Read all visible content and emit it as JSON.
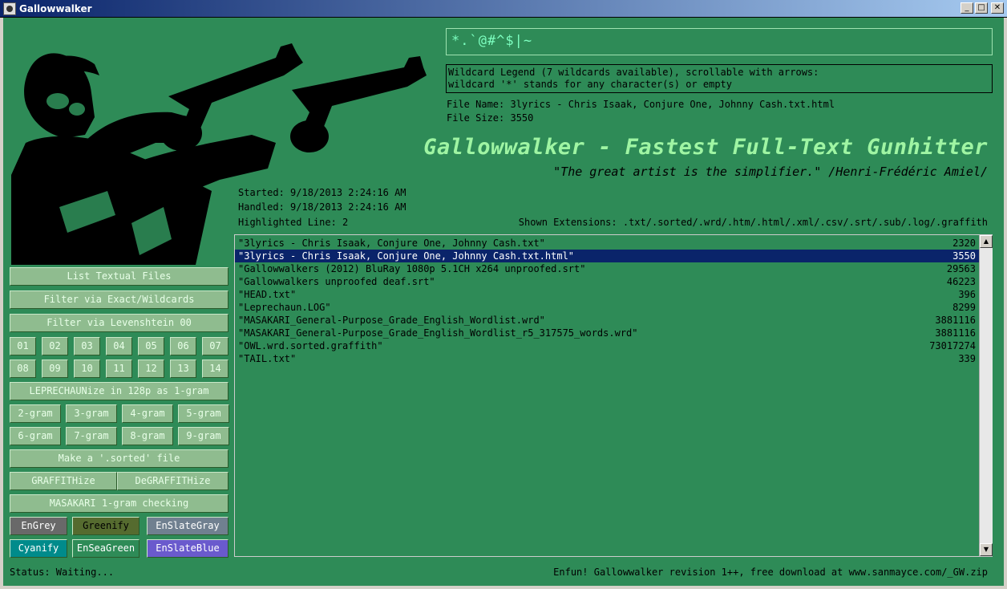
{
  "window": {
    "title": "Gallowwalker",
    "min": "_",
    "max": "□",
    "close": "✕"
  },
  "search": {
    "value": "*.`@#^$|~"
  },
  "legend": {
    "line1": "Wildcard Legend (7 wildcards available), scrollable with arrows:",
    "line2": "wildcard '*' stands for any character(s) or empty"
  },
  "file_info": {
    "name": "File Name: 3lyrics - Chris Isaak, Conjure One, Johnny Cash.txt.html",
    "size": "File Size: 3550"
  },
  "headline": {
    "title": "Gallowwalker - Fastest Full-Text Gunhitter",
    "quote": "\"The great artist is the simplifier.\" /Henri-Frédéric Amiel/"
  },
  "timing": {
    "started": "Started: 9/18/2013 2:24:16 AM",
    "handled": "Handled: 9/18/2013 2:24:16 AM",
    "highlighted": "Highlighted Line: 2",
    "extensions": "Shown Extensions: .txt/.sorted/.wrd/.htm/.html/.xml/.csv/.srt/.sub/.log/.graffith"
  },
  "files": [
    {
      "name": "\"3lyrics - Chris Isaak, Conjure One, Johnny Cash.txt\"",
      "size": "2320"
    },
    {
      "name": "\"3lyrics - Chris Isaak, Conjure One, Johnny Cash.txt.html\"",
      "size": "3550",
      "selected": true
    },
    {
      "name": "\"Gallowwalkers (2012) BluRay 1080p 5.1CH x264 unproofed.srt\"",
      "size": "29563"
    },
    {
      "name": "\"Gallowwalkers unproofed deaf.srt\"",
      "size": "46223"
    },
    {
      "name": "\"HEAD.txt\"",
      "size": "396"
    },
    {
      "name": "\"Leprechaun.LOG\"",
      "size": "8299"
    },
    {
      "name": "\"MASAKARI_General-Purpose_Grade_English_Wordlist.wrd\"",
      "size": "3881116"
    },
    {
      "name": "\"MASAKARI_General-Purpose_Grade_English_Wordlist_r5_317575_words.wrd\"",
      "size": "3881116"
    },
    {
      "name": "\"OWL.wrd.sorted.graffith\"",
      "size": "73017274"
    },
    {
      "name": "\"TAIL.txt\"",
      "size": "339"
    }
  ],
  "buttons": {
    "list": "List Textual Files",
    "filter_exact": "Filter via Exact/Wildcards",
    "filter_lev": "Filter via Levenshtein 00",
    "nums": [
      "01",
      "02",
      "03",
      "04",
      "05",
      "06",
      "07",
      "08",
      "09",
      "10",
      "11",
      "12",
      "13",
      "14"
    ],
    "leprechaun": "LEPRECHAUNize in 128p as 1-gram",
    "grams": [
      "2-gram",
      "3-gram",
      "4-gram",
      "5-gram",
      "6-gram",
      "7-gram",
      "8-gram",
      "9-gram"
    ],
    "sorted": "Make a '.sorted' file",
    "graffiti": "GRAFFITHize",
    "degraffiti": "DeGRAFFITHize",
    "masakari": "MASAKARI 1-gram checking",
    "themes": [
      "EnGrey",
      "Greenify",
      "EnSlateGray",
      "Cyanify",
      "EnSeaGreen",
      "EnSlateBlue"
    ]
  },
  "theme_colors": [
    "#696969",
    "#556b2f",
    "#708090",
    "#008b8b",
    "#2e8b57",
    "#6a5acd"
  ],
  "status": "Status: Waiting...",
  "footer": "Enfun! Gallowwalker revision 1++, free download at www.sanmayce.com/_GW.zip"
}
